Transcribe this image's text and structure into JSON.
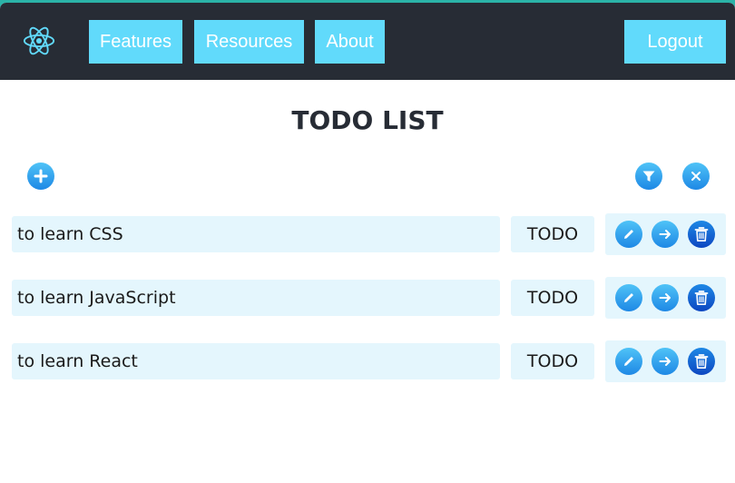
{
  "nav": {
    "logo_icon": "react-atom-icon",
    "items": [
      {
        "label": "Features"
      },
      {
        "label": "Resources"
      },
      {
        "label": "About"
      }
    ],
    "logout_label": "Logout"
  },
  "page": {
    "title": "TODO LIST"
  },
  "toolbar": {
    "add_icon": "plus-icon",
    "filter_icon": "filter-icon",
    "clear_icon": "close-icon"
  },
  "todos": [
    {
      "text": "to learn CSS",
      "status": "TODO"
    },
    {
      "text": "to learn JavaScript",
      "status": "TODO"
    },
    {
      "text": "to learn React",
      "status": "TODO"
    }
  ],
  "colors": {
    "navbar": "#272c35",
    "accent": "#61dafb",
    "row_bg": "#e4f6fd",
    "button_blue": "#1e88e5"
  }
}
